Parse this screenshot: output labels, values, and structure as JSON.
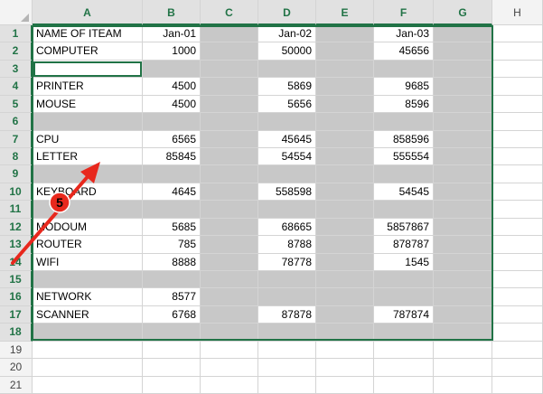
{
  "columns": [
    "A",
    "B",
    "C",
    "D",
    "E",
    "F",
    "G",
    "H"
  ],
  "rows": [
    {
      "num": "1",
      "a": "NAME OF ITEAM",
      "b": "Jan-01",
      "d": "Jan-02",
      "f": "Jan-03"
    },
    {
      "num": "2",
      "a": "COMPUTER",
      "b": "1000",
      "d": "50000",
      "f": "45656"
    },
    {
      "num": "3",
      "a": "",
      "b": "",
      "d": "",
      "f": ""
    },
    {
      "num": "4",
      "a": "PRINTER",
      "b": "4500",
      "d": "5869",
      "f": "9685"
    },
    {
      "num": "5",
      "a": "MOUSE",
      "b": "4500",
      "d": "5656",
      "f": "8596"
    },
    {
      "num": "6",
      "a": "",
      "b": "",
      "d": "",
      "f": ""
    },
    {
      "num": "7",
      "a": "CPU",
      "b": "6565",
      "d": "45645",
      "f": "858596"
    },
    {
      "num": "8",
      "a": "LETTER",
      "b": "85845",
      "d": "54554",
      "f": "555554"
    },
    {
      "num": "9",
      "a": "",
      "b": "",
      "d": "",
      "f": ""
    },
    {
      "num": "10",
      "a": "KEYBOARD",
      "b": "4645",
      "d": "558598",
      "f": "54545"
    },
    {
      "num": "11",
      "a": "",
      "b": "",
      "d": "",
      "f": ""
    },
    {
      "num": "12",
      "a": "MODOUM",
      "b": "5685",
      "d": "68665",
      "f": "5857867"
    },
    {
      "num": "13",
      "a": "ROUTER",
      "b": "785",
      "d": "8788",
      "f": "878787"
    },
    {
      "num": "14",
      "a": "WIFI",
      "b": "8888",
      "d": "78778",
      "f": "1545"
    },
    {
      "num": "15",
      "a": "",
      "b": "",
      "d": "",
      "f": ""
    },
    {
      "num": "16",
      "a": "NETWORK",
      "b": "8577",
      "d": "",
      "f": ""
    },
    {
      "num": "17",
      "a": "SCANNER",
      "b": "6768",
      "d": "87878",
      "f": "787874"
    },
    {
      "num": "18",
      "a": "",
      "b": "",
      "d": "",
      "f": ""
    },
    {
      "num": "19",
      "a": "",
      "b": "",
      "d": "",
      "f": ""
    },
    {
      "num": "20",
      "a": "",
      "b": "",
      "d": "",
      "f": ""
    },
    {
      "num": "21",
      "a": "",
      "b": "",
      "d": "",
      "f": ""
    }
  ],
  "annotation": {
    "step": "5",
    "color": "#e8281d"
  }
}
